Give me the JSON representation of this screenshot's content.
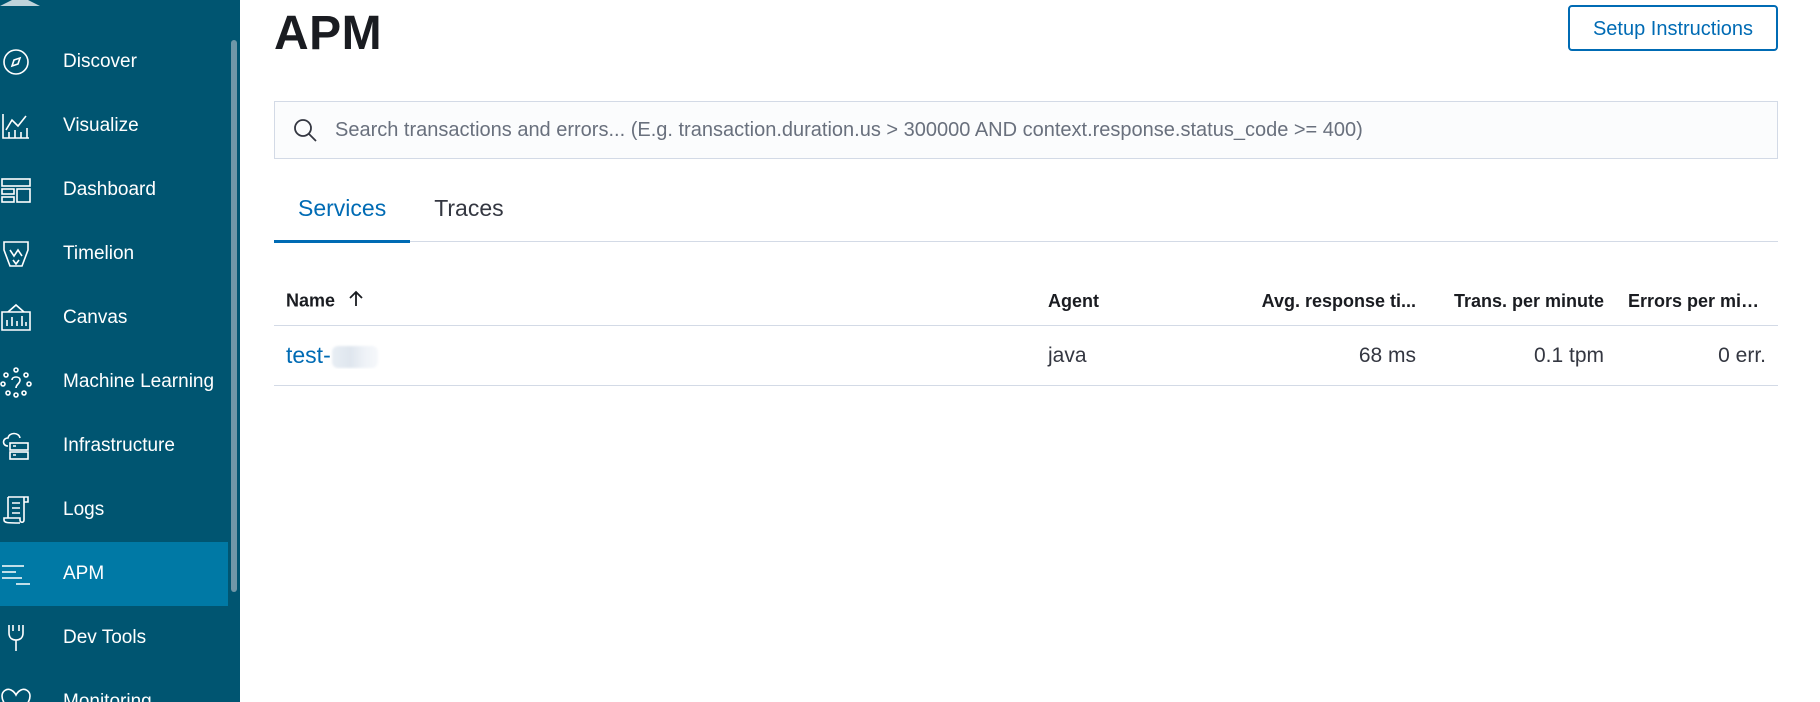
{
  "sidebar": {
    "items": [
      {
        "label": "Discover",
        "icon": "compass-icon",
        "active": false
      },
      {
        "label": "Visualize",
        "icon": "visualize-icon",
        "active": false
      },
      {
        "label": "Dashboard",
        "icon": "dashboard-icon",
        "active": false
      },
      {
        "label": "Timelion",
        "icon": "timelion-icon",
        "active": false
      },
      {
        "label": "Canvas",
        "icon": "canvas-icon",
        "active": false
      },
      {
        "label": "Machine Learning",
        "icon": "machine-learning-icon",
        "active": false
      },
      {
        "label": "Infrastructure",
        "icon": "infrastructure-icon",
        "active": false
      },
      {
        "label": "Logs",
        "icon": "logs-icon",
        "active": false
      },
      {
        "label": "APM",
        "icon": "apm-icon",
        "active": true
      },
      {
        "label": "Dev Tools",
        "icon": "dev-tools-icon",
        "active": false
      },
      {
        "label": "Monitoring",
        "icon": "monitoring-icon",
        "active": false
      }
    ]
  },
  "header": {
    "title": "APM",
    "setup_label": "Setup Instructions"
  },
  "search": {
    "placeholder": "Search transactions and errors... (E.g. transaction.duration.us > 300000 AND context.response.status_code >= 400)",
    "value": ""
  },
  "tabs": [
    {
      "label": "Services",
      "active": true
    },
    {
      "label": "Traces",
      "active": false
    }
  ],
  "table": {
    "columns": {
      "name": "Name",
      "agent": "Agent",
      "avg": "Avg. response ti...",
      "trans": "Trans. per minute",
      "errors": "Errors per minute"
    },
    "rows": [
      {
        "name": "test-",
        "agent": "java",
        "avg": "68 ms",
        "trans": "0.1 tpm",
        "errors": "0 err."
      }
    ]
  },
  "colors": {
    "sidebar_bg": "#005571",
    "sidebar_active": "#0079a5",
    "accent": "#006bb4"
  }
}
